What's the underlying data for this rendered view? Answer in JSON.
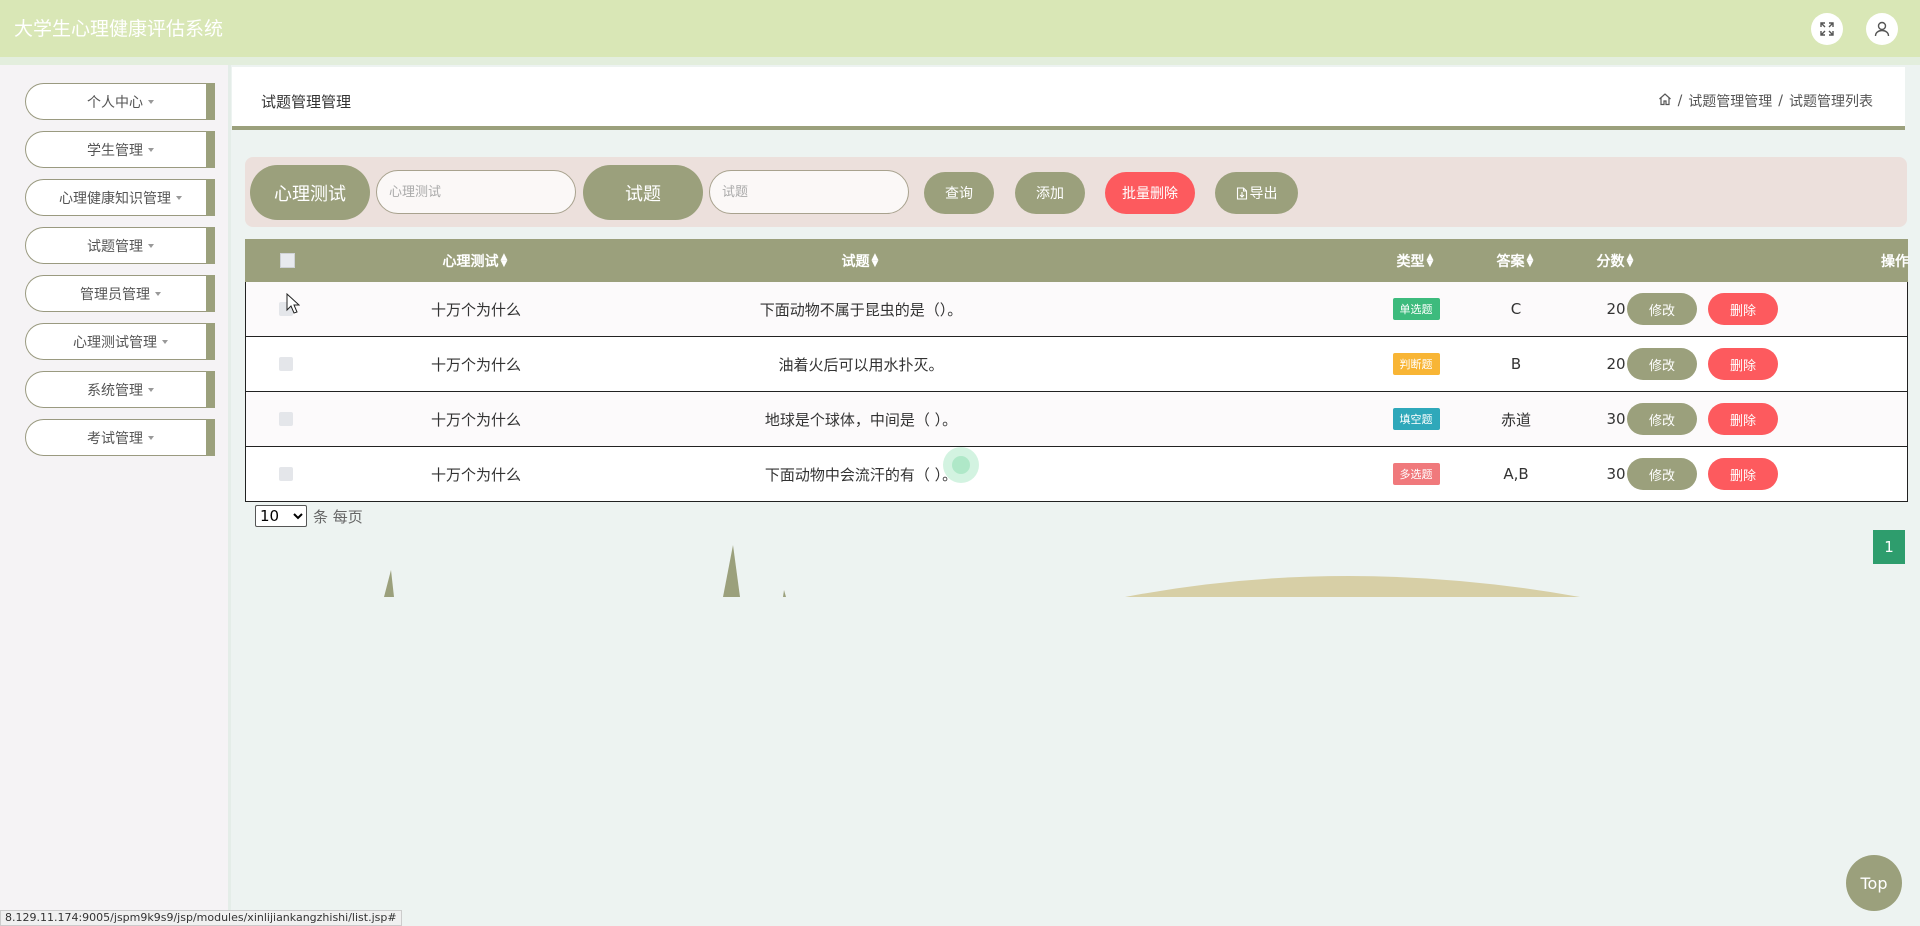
{
  "app": {
    "title": "大学生心理健康评估系统"
  },
  "header_icons": {
    "fullscreen": "fullscreen-icon",
    "user": "user-icon"
  },
  "sidebar": {
    "items": [
      {
        "label": "个人中心"
      },
      {
        "label": "学生管理"
      },
      {
        "label": "心理健康知识管理"
      },
      {
        "label": "试题管理"
      },
      {
        "label": "管理员管理"
      },
      {
        "label": "心理测试管理"
      },
      {
        "label": "系统管理"
      },
      {
        "label": "考试管理"
      }
    ]
  },
  "content": {
    "title": "试题管理管理",
    "breadcrumb": {
      "sep": "/",
      "items": [
        "试题管理管理",
        "试题管理列表"
      ]
    }
  },
  "search": {
    "label_test": "心理测试",
    "placeholder_test": "心理测试",
    "label_question": "试题",
    "placeholder_question": "试题",
    "query_btn": "查询",
    "add_btn": "添加",
    "batch_delete_btn": "批量删除",
    "export_btn": "导出"
  },
  "table": {
    "columns": [
      "心理测试",
      "试题",
      "类型",
      "答案",
      "分数",
      "操作"
    ],
    "rows": [
      {
        "test": "十万个为什么",
        "question": "下面动物不属于昆虫的是（）。",
        "type": "单选题",
        "type_color": "#3dbb7d",
        "answer": "C",
        "score": "20"
      },
      {
        "test": "十万个为什么",
        "question": "油着火后可以用水扑灭。",
        "type": "判断题",
        "type_color": "#f8b535",
        "answer": "B",
        "score": "20"
      },
      {
        "test": "十万个为什么",
        "question": "地球是个球体，中间是（ ）。",
        "type": "填空题",
        "type_color": "#2fa8ba",
        "answer": "赤道",
        "score": "30"
      },
      {
        "test": "十万个为什么",
        "question": "下面动物中会流汗的有（ ）。",
        "type": "多选题",
        "type_color": "#f0797c",
        "answer": "A,B",
        "score": "30"
      }
    ],
    "edit_label": "修改",
    "delete_label": "删除"
  },
  "pagination": {
    "page_size": "10",
    "per_page_text": "条 每页",
    "current_page": "1"
  },
  "back_to_top": "Top",
  "status_url": "8.129.11.174:9005/jspm9k9s9/jsp/modules/xinlijiankangzhishi/list.jsp#",
  "colors": {
    "accent": "#9ba07c",
    "danger": "#fd5a5e",
    "topbar": "#d9e7b6",
    "page_active": "#2e9d6d"
  }
}
